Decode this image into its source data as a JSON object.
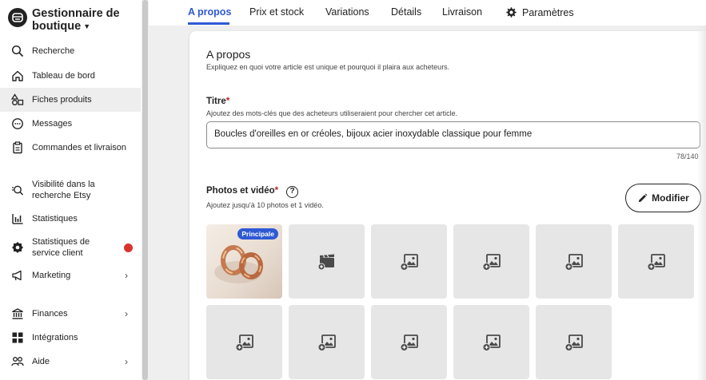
{
  "sidebar": {
    "brand_title": "Gestionnaire de boutique",
    "items": [
      {
        "label": "Recherche",
        "icon": "search-icon"
      },
      {
        "label": "Tableau de bord",
        "icon": "home-icon"
      },
      {
        "label": "Fiches produits",
        "icon": "shapes-icon",
        "active": true
      },
      {
        "label": "Messages",
        "icon": "chat-icon"
      },
      {
        "label": "Commandes et livraison",
        "icon": "clipboard-icon"
      },
      {
        "label": "Visibilité dans la recherche Etsy",
        "icon": "search-visibility-icon"
      },
      {
        "label": "Statistiques",
        "icon": "bar-chart-icon"
      },
      {
        "label": "Statistiques de service client",
        "icon": "badge-icon",
        "alert_color": "#d9342b"
      },
      {
        "label": "Marketing",
        "icon": "megaphone-icon",
        "has_submenu": true
      },
      {
        "label": "Finances",
        "icon": "bank-icon",
        "has_submenu": true
      },
      {
        "label": "Intégrations",
        "icon": "grid-icon"
      },
      {
        "label": "Aide",
        "icon": "people-icon",
        "has_submenu": true
      }
    ]
  },
  "tabs": [
    {
      "label": "A propos",
      "active": true
    },
    {
      "label": "Prix et stock"
    },
    {
      "label": "Variations"
    },
    {
      "label": "Détails"
    },
    {
      "label": "Livraison"
    },
    {
      "label": "Paramètres",
      "icon": "gear-icon"
    }
  ],
  "about": {
    "heading": "A propos",
    "subheading": "Expliquez en quoi votre article est unique et pourquoi il plaira aux acheteurs."
  },
  "title_field": {
    "label": "Titre",
    "required_mark": "*",
    "hint": "Ajoutez des mots-clés que des acheteurs utiliseraient pour chercher cet article.",
    "value": "Boucles d'oreilles en or créoles, bijoux acier inoxydable classique pour femme",
    "counter": "78/140"
  },
  "media": {
    "label": "Photos et vidéo",
    "required_mark": "*",
    "help_icon": "?",
    "hint": "Ajoutez jusqu'à 10 photos et 1 vidéo.",
    "edit_button": "Modifier",
    "main_badge": "Principale",
    "slots": [
      {
        "type": "photo-filled",
        "icon": "earrings-photo"
      },
      {
        "type": "video-empty",
        "icon": "add-video-icon"
      },
      {
        "type": "photo-empty",
        "icon": "add-photo-icon"
      },
      {
        "type": "photo-empty",
        "icon": "add-photo-icon"
      },
      {
        "type": "photo-empty",
        "icon": "add-photo-icon"
      },
      {
        "type": "photo-empty",
        "icon": "add-photo-icon"
      },
      {
        "type": "photo-empty",
        "icon": "add-photo-icon"
      },
      {
        "type": "photo-empty",
        "icon": "add-photo-icon"
      },
      {
        "type": "photo-empty",
        "icon": "add-photo-icon"
      },
      {
        "type": "photo-empty",
        "icon": "add-photo-icon"
      },
      {
        "type": "photo-empty",
        "icon": "add-photo-icon"
      }
    ]
  },
  "colors": {
    "accent": "#2f59d4",
    "required": "#b3261e",
    "alert": "#d9342b",
    "slot_bg": "#e6e6e6"
  }
}
